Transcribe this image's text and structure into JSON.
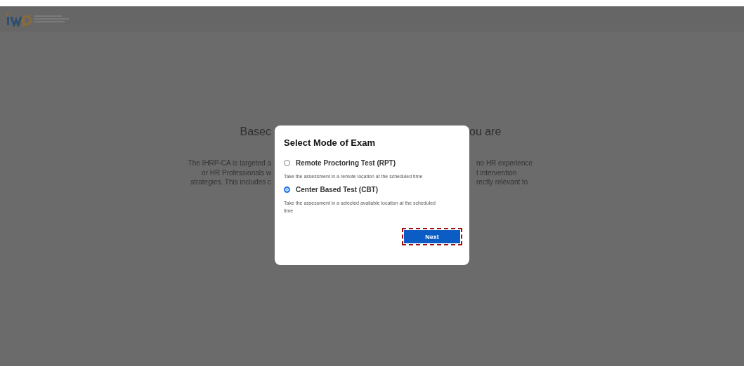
{
  "background": {
    "heading_left": "Basec",
    "heading_right": "ou are",
    "lines_left": [
      "The IHRP-CA is targeted a",
      "or HR Professionals w",
      "strategies. This includes c"
    ],
    "lines_right": [
      "no HR experience",
      "t intervention",
      "rectly relevant to"
    ]
  },
  "dialog": {
    "title": "Select Mode of Exam",
    "options": [
      {
        "label": "Remote Proctoring Test (RPT)",
        "description": "Take the assessment in a remote location at the scheduled time",
        "selected": false
      },
      {
        "label": "Center Based Test (CBT)",
        "description": "Take the assessment in a selected available location at the scheduled time",
        "selected": true
      }
    ],
    "button": "Next"
  }
}
